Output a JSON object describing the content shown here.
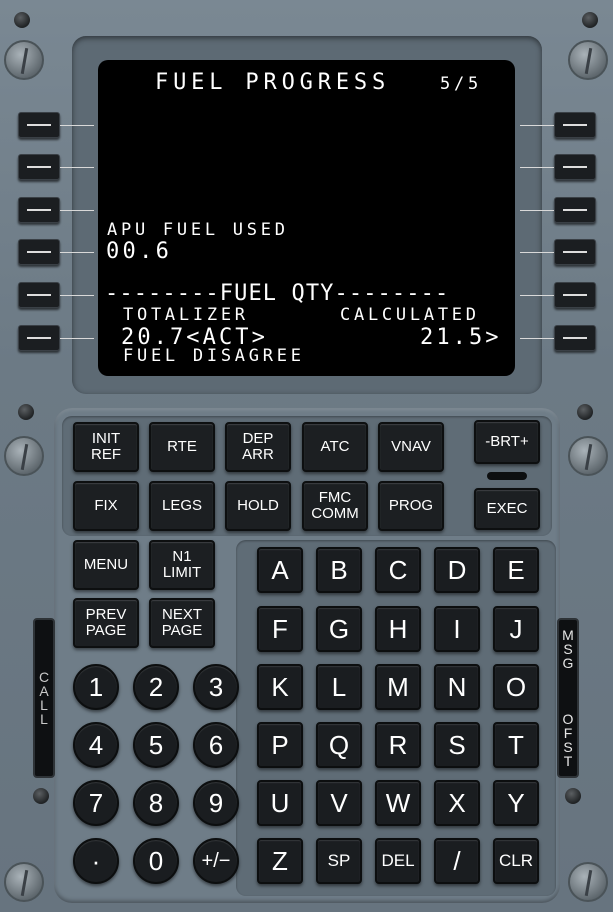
{
  "screen": {
    "title": "FUEL PROGRESS",
    "page": "5/5",
    "apu_label": "APU FUEL USED",
    "apu_value": "00.6",
    "fuel_qty_header": "--------FUEL QTY--------",
    "totalizer_label": "TOTALIZER",
    "calculated_label": "CALCULATED",
    "totalizer_value": "20.7<ACT>",
    "calculated_value": "21.5>",
    "disagree_label": "FUEL DISAGREE"
  },
  "function_keys": {
    "init_ref": "INIT\nREF",
    "rte": "RTE",
    "dep_arr": "DEP\nARR",
    "atc": "ATC",
    "vnav": "VNAV",
    "brt": "-BRT+",
    "fix": "FIX",
    "legs": "LEGS",
    "hold": "HOLD",
    "fmc_comm": "FMC\nCOMM",
    "prog": "PROG",
    "exec": "EXEC",
    "menu": "MENU",
    "n1_limit": "N1\nLIMIT",
    "prev_page": "PREV\nPAGE",
    "next_page": "NEXT\nPAGE"
  },
  "alpha_keys": [
    "A",
    "B",
    "C",
    "D",
    "E",
    "F",
    "G",
    "H",
    "I",
    "J",
    "K",
    "L",
    "M",
    "N",
    "O",
    "P",
    "Q",
    "R",
    "S",
    "T",
    "U",
    "V",
    "W",
    "X",
    "Y",
    "Z",
    "SP",
    "DEL",
    "/",
    "CLR"
  ],
  "numeric_keys": [
    "1",
    "2",
    "3",
    "4",
    "5",
    "6",
    "7",
    "8",
    "9",
    "·",
    "0",
    "+/−"
  ],
  "annunciators": {
    "call": [
      "C",
      "A",
      "L",
      "L"
    ],
    "msg": [
      "M",
      "S",
      "G"
    ],
    "ofst": [
      "O",
      "F",
      "S",
      "T"
    ]
  }
}
